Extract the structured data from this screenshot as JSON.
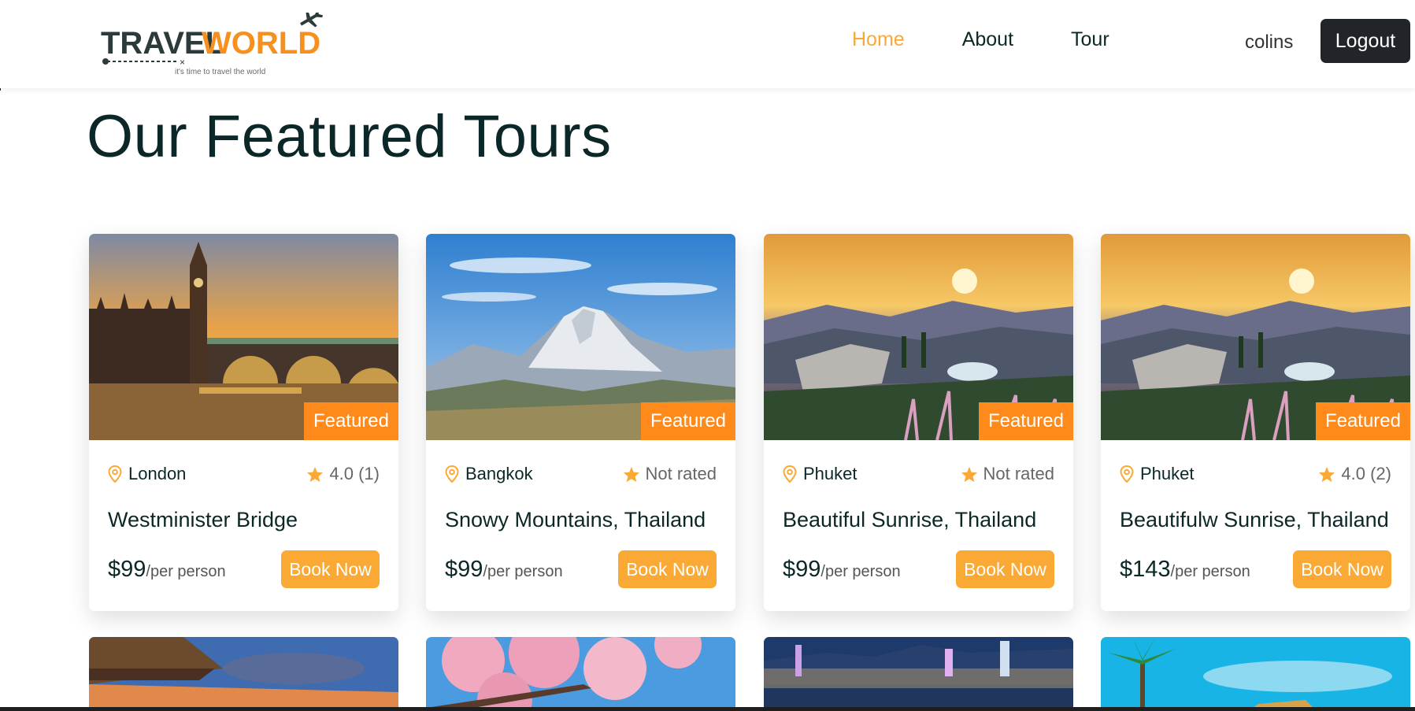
{
  "brand": {
    "logo_main_left": "TRAVEL",
    "logo_main_right": "WORLD",
    "tagline": "it's time to travel the world"
  },
  "nav": {
    "items": [
      {
        "label": "Home",
        "active": true
      },
      {
        "label": "About",
        "active": false
      },
      {
        "label": "Tour",
        "active": false
      }
    ]
  },
  "user": {
    "name": "colins",
    "logout_label": "Logout"
  },
  "page": {
    "title": "Our Featured Tours"
  },
  "colors": {
    "accent": "#faa935",
    "badge": "#fd8a1b",
    "dark": "#212529",
    "text": "#0b2727"
  },
  "tours": [
    {
      "city": "London",
      "rating": "4.0 (1)",
      "title": "Westminister Bridge",
      "price": "$99",
      "per": "/per person",
      "badge": "Featured",
      "book_label": "Book Now",
      "image": "big-ben-sunset"
    },
    {
      "city": "Bangkok",
      "rating": "Not rated",
      "title": "Snowy Mountains, Thailand",
      "price": "$99",
      "per": "/per person",
      "badge": "Featured",
      "book_label": "Book Now",
      "image": "snowy-mountain"
    },
    {
      "city": "Phuket",
      "rating": "Not rated",
      "title": "Beautiful Sunrise, Thailand",
      "price": "$99",
      "per": "/per person",
      "badge": "Featured",
      "book_label": "Book Now",
      "image": "sunrise-resort"
    },
    {
      "city": "Phuket",
      "rating": "4.0 (2)",
      "title": "Beautifulw Sunrise, Thailand",
      "price": "$143",
      "per": "/per person",
      "badge": "Featured",
      "book_label": "Book Now",
      "image": "sunrise-resort"
    }
  ],
  "icons": {
    "location": "map-pin-icon",
    "rating": "star-icon",
    "logo": "airplane-icon"
  }
}
